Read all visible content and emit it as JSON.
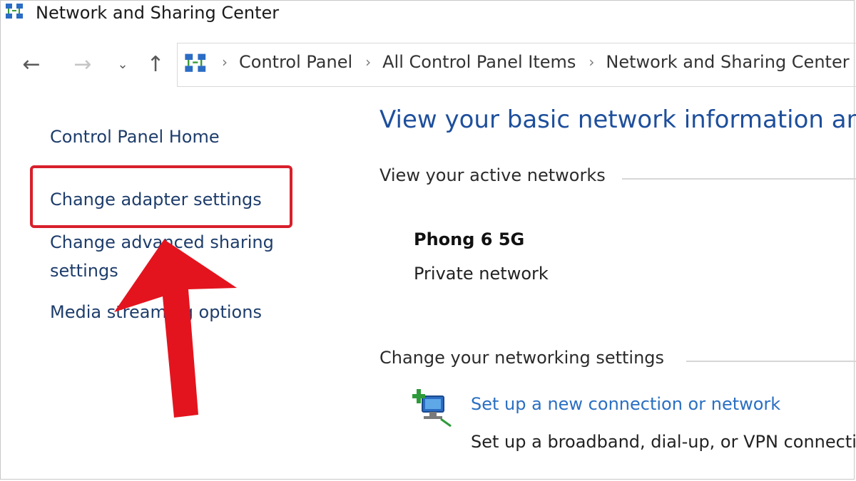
{
  "window": {
    "title": "Network and Sharing Center"
  },
  "nav": {
    "back_icon": "arrow-left-icon",
    "forward_icon": "arrow-right-icon",
    "recent_icon": "chevron-down-icon",
    "up_icon": "arrow-up-icon"
  },
  "breadcrumb": [
    "Control Panel",
    "All Control Panel Items",
    "Network and Sharing Center"
  ],
  "sidebar": {
    "items": [
      {
        "label": "Control Panel Home"
      },
      {
        "label": "Change adapter settings"
      },
      {
        "label": "Change advanced sharing"
      },
      {
        "label": "settings"
      },
      {
        "label": "Media streaming options"
      }
    ]
  },
  "main": {
    "title": "View your basic network information and set up connections",
    "active_networks_heading": "View your active networks",
    "network": {
      "name": "Phong 6 5G",
      "type": "Private network"
    },
    "change_settings_heading": "Change your networking settings",
    "setup": {
      "link": "Set up a new connection or network",
      "description": "Set up a broadband, dial-up, or VPN connection; or set up a router or access point."
    }
  },
  "colors": {
    "link": "#1e3d6b",
    "accent_link": "#2a6fc2",
    "title_blue": "#1e4f9c",
    "annotation_red": "#d8202c"
  }
}
